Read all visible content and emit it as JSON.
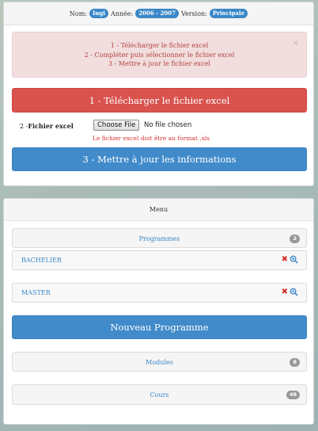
{
  "info": {
    "nom_label": "Nom:",
    "nom_value": "Ingi",
    "annee_label": "Année:",
    "annee_value": "2006 - 2007",
    "version_label": "Version:",
    "version_value": "Principale"
  },
  "alert": {
    "lines": [
      "1 - Télécharger le fichier excel",
      "2 - Compléter puis sélectionner le fichier excel",
      "3 - Mettre à jour le fichier excel"
    ],
    "close": "×"
  },
  "download_button": "1 - Télécharger le fichier excel",
  "file": {
    "label_prefix": "2 - ",
    "label": "Fichier excel",
    "choose_button": "Choose File",
    "no_file": "No file chosen",
    "error": "Le fichier excel doit être au format .xls"
  },
  "update_button": "3 - Mettre à jour les informations",
  "menu": {
    "title": "Menu",
    "programmes": {
      "label": "Programmes",
      "count": "2"
    },
    "items": [
      {
        "name": "BACHELIER"
      },
      {
        "name": "MASTER"
      }
    ],
    "new_program_button": "Nouveau Programme",
    "modules": {
      "label": "Modules",
      "count": "8"
    },
    "cours": {
      "label": "Cours",
      "count": "48"
    }
  },
  "colors": {
    "primary": "#428bca",
    "danger": "#d9534f",
    "alert_bg": "#f2dede",
    "badge": "#3a87c8"
  },
  "icons": {
    "delete": "x-icon",
    "view": "magnifier-icon",
    "close": "close-icon"
  }
}
